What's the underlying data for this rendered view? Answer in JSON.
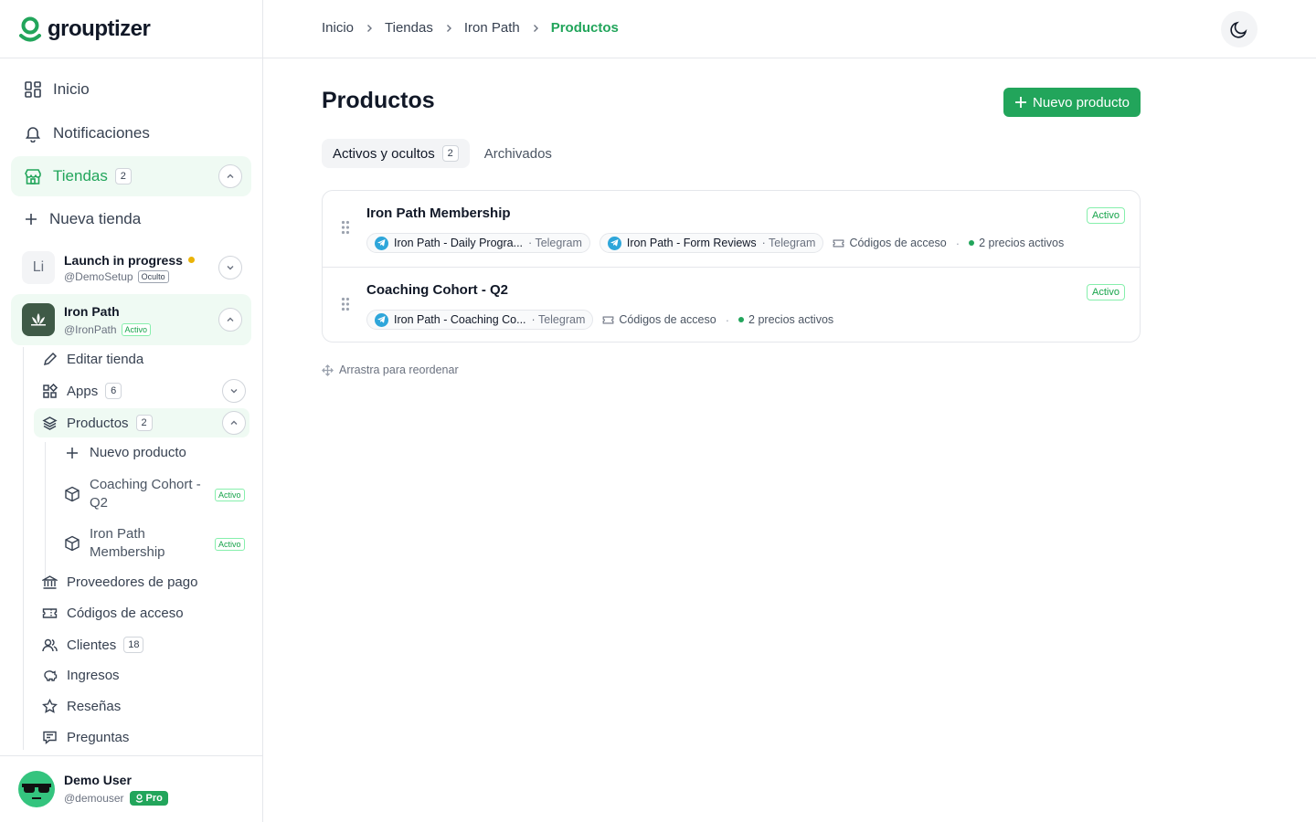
{
  "brand": {
    "name": "grouptizer",
    "color": "#22a55b"
  },
  "sidebar": {
    "home": "Inicio",
    "notifications": "Notificaciones",
    "stores": {
      "label": "Tiendas",
      "count": "2"
    },
    "new_store": "Nueva tienda",
    "store1": {
      "initials": "Li",
      "name": "Launch in progress",
      "handle": "@DemoSetup",
      "badge": "Oculto"
    },
    "store2": {
      "name": "Iron Path",
      "handle": "@IronPath",
      "badge": "Activo"
    },
    "edit_store": "Editar tienda",
    "apps": {
      "label": "Apps",
      "count": "6"
    },
    "products": {
      "label": "Productos",
      "count": "2"
    },
    "new_product": "Nuevo producto",
    "product_items": [
      {
        "line1": "Coaching Cohort -",
        "line2": "Q2",
        "badge": "Activo"
      },
      {
        "line1": "Iron Path",
        "line2": "Membership",
        "badge": "Activo"
      }
    ],
    "payment_providers": "Proveedores de pago",
    "access_codes": "Códigos de acceso",
    "clients": {
      "label": "Clientes",
      "count": "18"
    },
    "income": "Ingresos",
    "reviews": "Reseñas",
    "questions": "Preguntas"
  },
  "user": {
    "name": "Demo User",
    "handle": "@demouser",
    "plan": "Pro"
  },
  "breadcrumb": [
    "Inicio",
    "Tiendas",
    "Iron Path",
    "Productos"
  ],
  "page": {
    "title": "Productos",
    "new_button": "Nuevo producto",
    "tabs": {
      "active_label": "Activos y ocultos",
      "active_count": "2",
      "archived": "Archivados"
    },
    "products": [
      {
        "name": "Iron Path Membership",
        "status": "Activo",
        "channels": [
          {
            "name": "Iron Path - Daily Progra...",
            "platform": "Telegram"
          },
          {
            "name": "Iron Path - Form Reviews",
            "platform": "Telegram"
          }
        ],
        "access": "Códigos de acceso",
        "prices": "2 precios activos"
      },
      {
        "name": "Coaching Cohort - Q2",
        "status": "Activo",
        "channels": [
          {
            "name": "Iron Path - Coaching Co...",
            "platform": "Telegram"
          }
        ],
        "access": "Códigos de acceso",
        "prices": "2 precios activos"
      }
    ],
    "reorder_hint": "Arrastra para reordenar"
  }
}
